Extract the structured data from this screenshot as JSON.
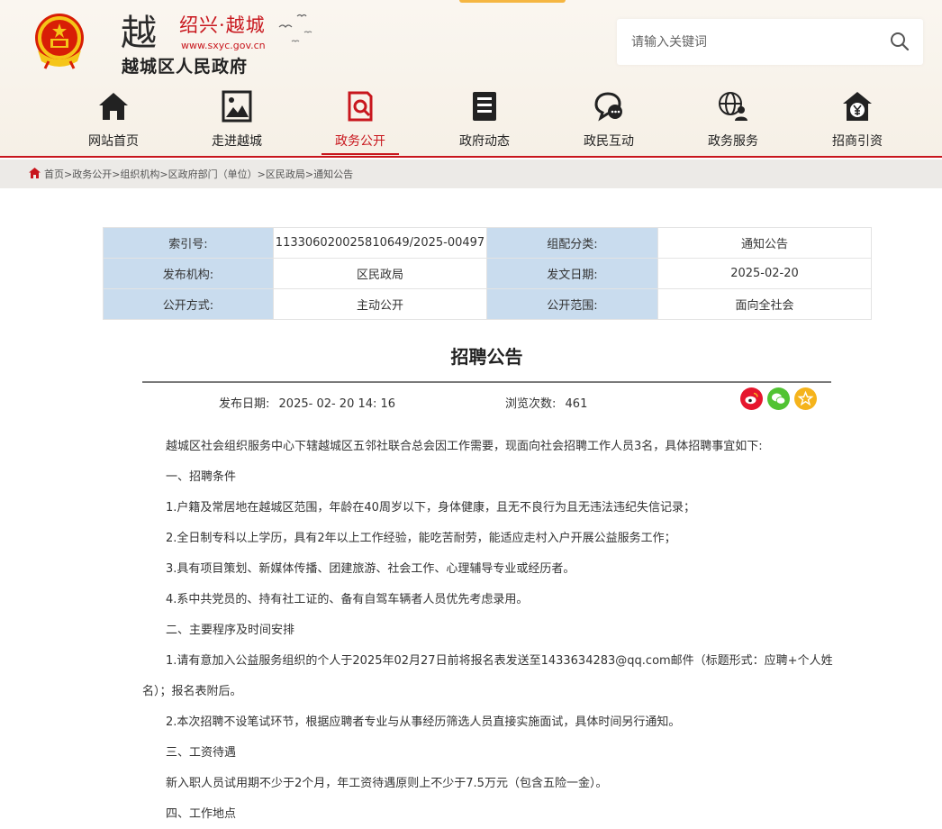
{
  "header": {
    "brand_cn": "绍兴·越城",
    "brand_url": "www.sxyc.gov.cn",
    "site_name": "越城区人民政府",
    "logo_char": "越"
  },
  "search": {
    "placeholder": "请输入关键词"
  },
  "nav": [
    {
      "label": "网站首页",
      "icon": "home-icon"
    },
    {
      "label": "走进越城",
      "icon": "picture-icon"
    },
    {
      "label": "政务公开",
      "icon": "document-search-icon",
      "active": true
    },
    {
      "label": "政府动态",
      "icon": "news-list-icon"
    },
    {
      "label": "政民互动",
      "icon": "chat-bubbles-icon"
    },
    {
      "label": "政务服务",
      "icon": "globe-user-icon"
    },
    {
      "label": "招商引资",
      "icon": "yuan-house-icon"
    }
  ],
  "breadcrumb": "首页>政务公开>组织机构>区政府部门（单位）>区民政局>通知公告",
  "meta": {
    "index_label": "索引号:",
    "index_value": "113306020025810649/2025-00497",
    "category_label": "组配分类:",
    "category_value": "通知公告",
    "org_label": "发布机构:",
    "org_value": "区民政局",
    "date_label": "发文日期:",
    "date_value": "2025-02-20",
    "method_label": "公开方式:",
    "method_value": "主动公开",
    "scope_label": "公开范围:",
    "scope_value": "面向全社会"
  },
  "article": {
    "title": "招聘公告",
    "publish_label": "发布日期:",
    "publish_value": "2025- 02- 20 14: 16",
    "views_label": "浏览次数:",
    "views_value": "461",
    "paragraphs": [
      "越城区社会组织服务中心下辖越城区五邻社联合总会因工作需要，现面向社会招聘工作人员3名，具体招聘事宜如下:",
      "一、招聘条件",
      "1.户籍及常居地在越城区范围，年龄在40周岁以下，身体健康，且无不良行为且无违法违纪失信记录；",
      "2.全日制专科以上学历，具有2年以上工作经验，能吃苦耐劳，能适应走村入户开展公益服务工作；",
      "3.具有项目策划、新媒体传播、团建旅游、社会工作、心理辅导专业或经历者。",
      "4.系中共党员的、持有社工证的、备有自驾车辆者人员优先考虑录用。",
      "二、主要程序及时间安排",
      "1.请有意加入公益服务组织的个人于2025年02月27日前将报名表发送至1433634283@qq.com邮件（标题形式：应聘+个人姓",
      "名）；报名表附后。",
      "2.本次招聘不设笔试环节，根据应聘者专业与从事经历筛选人员直接实施面试，具体时间另行通知。",
      "三、工资待遇",
      "新入职人员试用期不少于2个月，年工资待遇原则上不少于7.5万元（包含五险一金）。",
      "四、工作地点"
    ]
  },
  "colors": {
    "accent_red": "#c8161d",
    "meta_key_bg": "#c9dcee",
    "weibo": "#e6162d",
    "wechat": "#51c332",
    "favorite": "#f5b31b"
  }
}
